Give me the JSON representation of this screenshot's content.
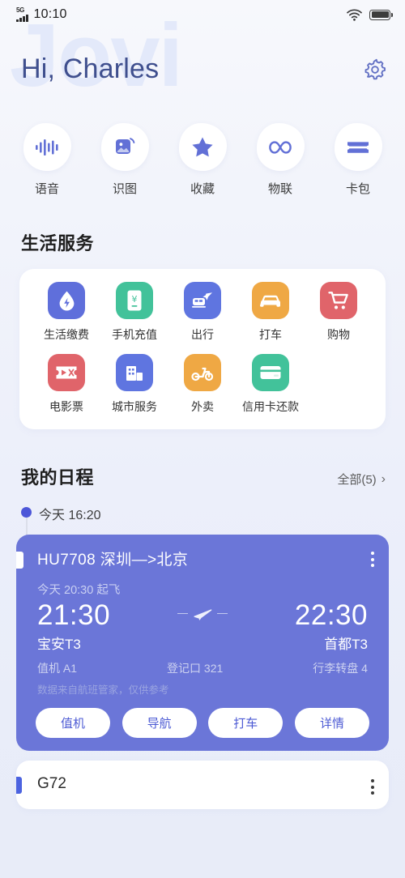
{
  "status_bar": {
    "network_label": "5G",
    "time": "10:10",
    "wifi_icon": "wifi-icon",
    "battery_icon": "battery-full-icon"
  },
  "header": {
    "watermark": "Jovi",
    "greeting": "Hi, Charles",
    "settings_icon": "gear-icon"
  },
  "quick_actions": [
    {
      "label": "语音",
      "icon": "waveform-icon"
    },
    {
      "label": "识图",
      "icon": "image-scan-icon"
    },
    {
      "label": "收藏",
      "icon": "star-icon"
    },
    {
      "label": "物联",
      "icon": "infinity-icon"
    },
    {
      "label": "卡包",
      "icon": "ticket-icon"
    }
  ],
  "life_services": {
    "title": "生活服务",
    "items": [
      {
        "label": "生活缴费",
        "icon": "water-drop-bolt-icon",
        "color": "#5f6fdb"
      },
      {
        "label": "手机充值",
        "icon": "phone-yen-icon",
        "color": "#42c29a"
      },
      {
        "label": "出行",
        "icon": "train-plane-icon",
        "color": "#5f75e0"
      },
      {
        "label": "打车",
        "icon": "car-icon",
        "color": "#efa844"
      },
      {
        "label": "购物",
        "icon": "shopping-cart-icon",
        "color": "#e0646a"
      },
      {
        "label": "电影票",
        "icon": "movie-ticket-icon",
        "color": "#e0646a"
      },
      {
        "label": "城市服务",
        "icon": "city-building-icon",
        "color": "#5f75e0"
      },
      {
        "label": "外卖",
        "icon": "scooter-icon",
        "color": "#efa844"
      },
      {
        "label": "信用卡还款",
        "icon": "credit-card-icon",
        "color": "#42c29a"
      }
    ]
  },
  "schedule": {
    "title": "我的日程",
    "all_link": "全部(5)",
    "chevron": "›",
    "timeline_time": "今天 16:20",
    "flight_card": {
      "accent_color": "#6b76d8",
      "title": "HU7708 深圳—>北京",
      "subtitle": "今天 20:30 起飞",
      "depart_time": "21:30",
      "arrive_time": "22:30",
      "depart_terminal": "宝安T3",
      "arrive_terminal": "首都T3",
      "checkin": "值机 A1",
      "gate": "登记口 321",
      "baggage": "行李转盘 4",
      "note": "数据来自航班管家，仅供参考",
      "plane_icon": "airplane-icon",
      "menu_icon": "more-vertical-icon",
      "buttons": [
        "值机",
        "导航",
        "打车",
        "详情"
      ]
    },
    "next_card": {
      "title": "G72",
      "accent_color": "#4c63e0",
      "menu_icon": "more-vertical-icon"
    }
  }
}
